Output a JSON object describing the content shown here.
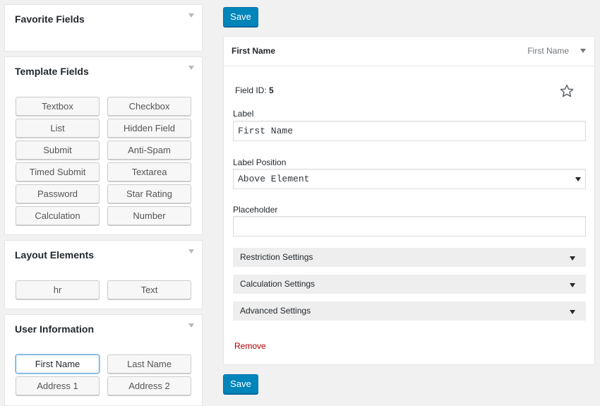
{
  "save_label": "Save",
  "favorite_fields": {
    "title": "Favorite Fields"
  },
  "template_fields": {
    "title": "Template Fields",
    "buttons": [
      "Textbox",
      "Checkbox",
      "List",
      "Hidden Field",
      "Submit",
      "Anti-Spam",
      "Timed Submit",
      "Textarea",
      "Password",
      "Star Rating",
      "Calculation",
      "Number"
    ]
  },
  "layout_elements": {
    "title": "Layout Elements",
    "buttons": [
      "hr",
      "Text"
    ]
  },
  "user_information": {
    "title": "User Information",
    "buttons": [
      "First Name",
      "Last Name",
      "Address 1",
      "Address 2"
    ]
  },
  "field": {
    "title": "First Name",
    "type": "First Name",
    "id_label": "Field ID:",
    "id_value": "5",
    "label_label": "Label",
    "label_value": "First Name",
    "label_position_label": "Label Position",
    "label_position_value": "Above Element",
    "placeholder_label": "Placeholder",
    "placeholder_value": "",
    "settings": [
      "Restriction Settings",
      "Calculation Settings",
      "Advanced Settings"
    ],
    "remove_label": "Remove"
  },
  "colors": {
    "primary": "#0085ba",
    "remove": "#aa0000",
    "active_border": "#5b9dd9"
  },
  "icons": {
    "favorite": "star-outline-icon",
    "toggle": "triangle-down-icon"
  }
}
